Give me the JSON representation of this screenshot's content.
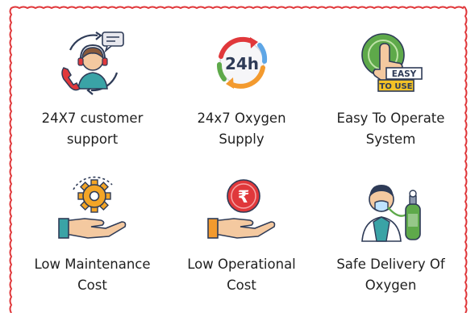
{
  "colors": {
    "border": "#e0383b",
    "text": "#1f1f1f",
    "accent_red": "#e0383b",
    "accent_orange": "#f39a2e",
    "accent_teal": "#3aa3a6",
    "accent_green": "#5ea94a",
    "skin": "#f4c9a0",
    "navy": "#2e3b57"
  },
  "features": [
    {
      "icon": "customer-support-headset-icon",
      "label": "24X7 customer\nsupport"
    },
    {
      "icon": "24h-oxygen-supply-icon",
      "label": "24x7 Oxygen\nSupply",
      "badge": "24h"
    },
    {
      "icon": "easy-to-use-hand-icon",
      "label": "Easy To Operate\nSystem",
      "badge_top": "EASY",
      "badge_bottom": "TO USE"
    },
    {
      "icon": "gear-hand-maintenance-icon",
      "label": "Low Maintenance\nCost"
    },
    {
      "icon": "rupee-coin-hand-icon",
      "label": "Low Operational\nCost",
      "badge": "₹"
    },
    {
      "icon": "patient-oxygen-mask-icon",
      "label": "Safe Delivery Of\nOxygen"
    }
  ]
}
